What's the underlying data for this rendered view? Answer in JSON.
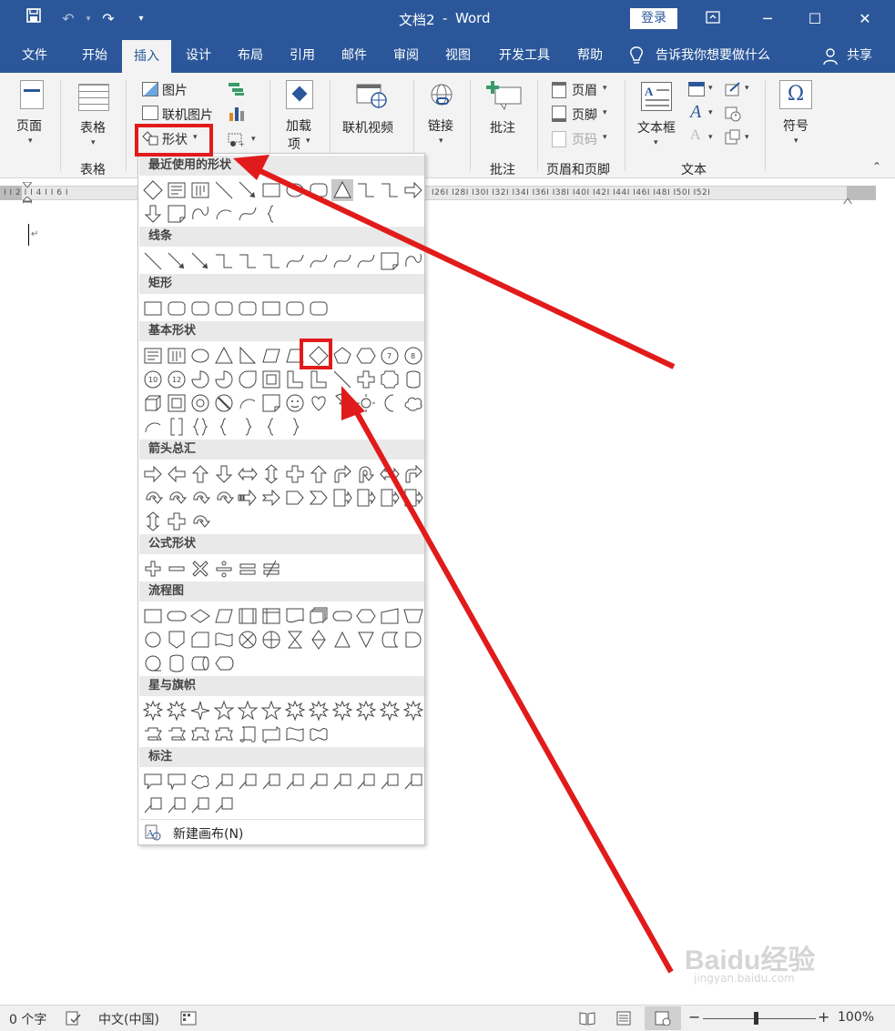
{
  "app": {
    "doc_title": "文档2",
    "app_name": "Word",
    "title_sep": "-",
    "login": "登录",
    "colors": {
      "brand": "#2b579a",
      "ribbon_bg": "#f3f3f3",
      "highlight_red": "#e11b1b"
    }
  },
  "quick_access": {
    "save_icon": "save-icon",
    "undo_icon": "undo-icon",
    "redo_icon": "redo-icon",
    "customize_icon": "customize-icon"
  },
  "menu": {
    "tabs": [
      "文件",
      "开始",
      "插入",
      "设计",
      "布局",
      "引用",
      "邮件",
      "审阅",
      "视图",
      "开发工具",
      "帮助"
    ],
    "active": "插入",
    "tell_me": "告诉我你想要做什么",
    "share": "共享"
  },
  "ribbon": {
    "pages": "页面",
    "table": "表格",
    "table_group": "表格",
    "pictures": "图片",
    "online_pictures": "联机图片",
    "shapes": "形状",
    "addins": "加载",
    "addins2": "项",
    "online_video": "联机视频",
    "links": "链接",
    "comment": "批注",
    "comment_group": "批注",
    "header": "页眉",
    "footer": "页脚",
    "page_number": "页码",
    "header_footer_group": "页眉和页脚",
    "textbox": "文本框",
    "text_group": "文本",
    "symbol": "符号",
    "symbol_glyph": "Ω"
  },
  "ruler": {
    "left_text": "I  I  2 I  I 4 I  I 6 I",
    "right_text": "I26I  I28I  I30I  I32I  I34I  I36I  I38I  I40I  I42I  I44I  I46I  I48I  I50I  I52I"
  },
  "shapes_panel": {
    "sections": [
      "最近使用的形状",
      "线条",
      "矩形",
      "基本形状",
      "箭头总汇",
      "公式形状",
      "流程图",
      "星与旗帜",
      "标注"
    ],
    "new_canvas": "新建画布(N)"
  },
  "status": {
    "word_count": "0 个字",
    "language": "中文(中国)",
    "zoom": "100%",
    "zoom_minus": "−",
    "zoom_plus": "+"
  },
  "watermark": {
    "brand": "Baidu经验",
    "url": "jingyan.baidu.com"
  }
}
